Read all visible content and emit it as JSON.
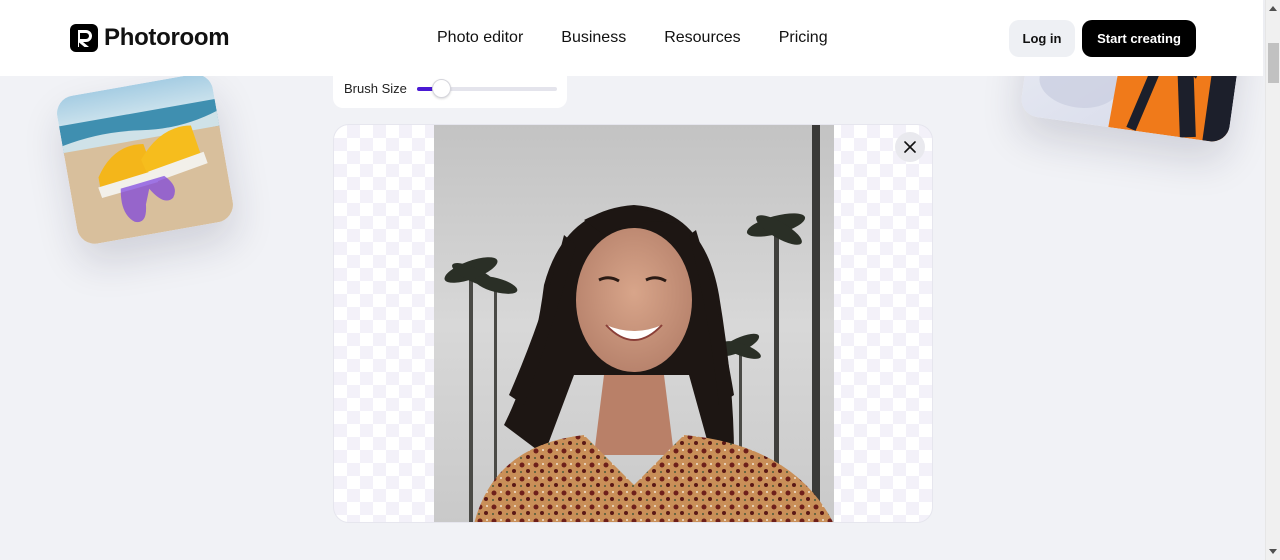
{
  "brand": {
    "name": "Photoroom",
    "logo_icon": "photoroom-logo-icon"
  },
  "nav": {
    "items": [
      {
        "label": "Photo editor"
      },
      {
        "label": "Business"
      },
      {
        "label": "Resources"
      },
      {
        "label": "Pricing"
      }
    ]
  },
  "header": {
    "login_label": "Log in",
    "start_label": "Start creating"
  },
  "editor": {
    "brush_label": "Brush Size",
    "brush_value_percent": 17,
    "accent_color": "#4a19d4",
    "close_icon": "close-icon",
    "photo_alt": "Smiling woman with dark hair in front of palm trees, background removed on sides"
  },
  "cards": {
    "left_alt": "Yellow sneakers on a beach with purple brush stroke",
    "right_alt": "Person wearing orange jacket with black backpack"
  }
}
